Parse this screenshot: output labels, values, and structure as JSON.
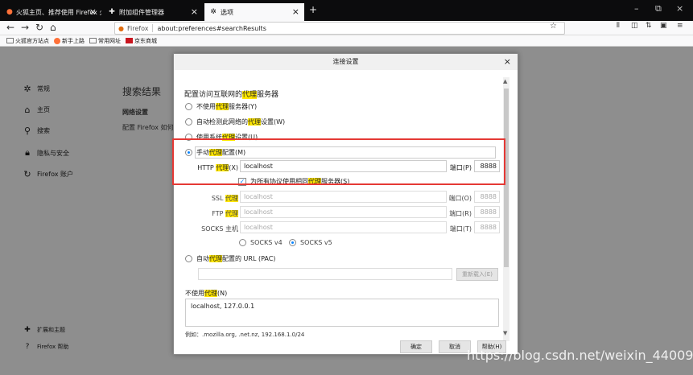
{
  "tabs": [
    {
      "label": "火狐主页、推荐使用 Firefox 火...",
      "icon": "firefox-icon"
    },
    {
      "label": "附加组件管理器",
      "icon": "puzzle-icon"
    },
    {
      "label": "选项",
      "icon": "gear-icon"
    }
  ],
  "nav": {
    "url_brand": "Firefox",
    "url": "about:preferences#searchResults"
  },
  "bookmarks": [
    "火狐官方站点",
    "新手上路",
    "常用网址",
    "京东商城"
  ],
  "sidebar": {
    "items": [
      "常规",
      "主页",
      "搜索",
      "隐私与安全",
      "Firefox 账户"
    ],
    "bottom": [
      "扩展和主题",
      "Firefox 帮助"
    ]
  },
  "page": {
    "search_results": "搜索结果",
    "network_heading": "网络设置",
    "network_desc": "配置 Firefox 如何"
  },
  "dialog": {
    "title": "连接设置",
    "heading_pre": "配置访问互联网的",
    "heading_hl": "代理",
    "heading_post": "服务器",
    "opt_none_pre": "不使用",
    "opt_none_hl": "代理",
    "opt_none_post": "服务器(Y)",
    "opt_auto_pre": "自动检测此网络的",
    "opt_auto_hl": "代理",
    "opt_auto_post": "设置(W)",
    "opt_system_pre": "使用系统",
    "opt_system_hl": "代理",
    "opt_system_post": "设置(U)",
    "opt_manual_pre": "手动",
    "opt_manual_hl": "代理",
    "opt_manual_post": "配置(M)",
    "http_label_pre": "HTTP ",
    "http_label_hl": "代理",
    "http_label_post": "(X)",
    "http_value": "localhost",
    "http_port_label": "端口(P)",
    "http_port": "8888",
    "all_protocols_pre": "为所有协议使用相同",
    "all_protocols_hl": "代理",
    "all_protocols_post": "服务器(S)",
    "ssl_label_pre": "SSL ",
    "ssl_label_hl": "代理",
    "ssl_value": "localhost",
    "ssl_port_label": "端口(O)",
    "ssl_port": "8888",
    "ftp_label_pre": "FTP ",
    "ftp_label_hl": "代理",
    "ftp_value": "localhost",
    "ftp_port_label": "端口(R)",
    "ftp_port": "8888",
    "socks_label": "SOCKS 主机",
    "socks_value": "localhost",
    "socks_port_label": "端口(T)",
    "socks_port": "8888",
    "socks_v4": "SOCKS v4",
    "socks_v5": "SOCKS v5",
    "opt_pac_pre": "自动",
    "opt_pac_hl": "代理",
    "opt_pac_post": "配置的 URL (PAC)",
    "reload": "重新载入(E)",
    "noproxy_pre": "不使用",
    "noproxy_hl": "代理",
    "noproxy_post": "(N)",
    "noproxy_value": "localhost, 127.0.0.1",
    "example": "例如：.mozilla.org, .net.nz, 192.168.1.0/24",
    "ok": "确定",
    "cancel": "取消",
    "help": "帮助(H)"
  },
  "watermark": "https://blog.csdn.net/weixin_44009675",
  "colors": {
    "highlight": "#ffe600",
    "annotation_box": "#e53935",
    "accent": "#0a84ff"
  }
}
